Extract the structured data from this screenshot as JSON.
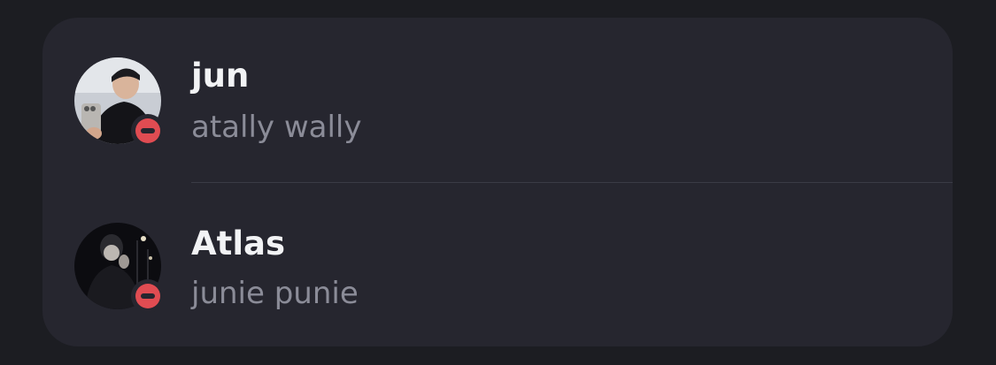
{
  "users": [
    {
      "name": "jun",
      "subtitle": "atally wally",
      "status": "do-not-disturb",
      "avatar": "profile-photo"
    },
    {
      "name": "Atlas",
      "subtitle": "junie punie",
      "status": "do-not-disturb",
      "avatar": "profile-photo"
    }
  ],
  "colors": {
    "background": "#1c1d22",
    "card": "#26262f",
    "name_text": "#f2f3f5",
    "subtitle_text": "#8b8c98",
    "dnd_status": "#e04c52"
  }
}
